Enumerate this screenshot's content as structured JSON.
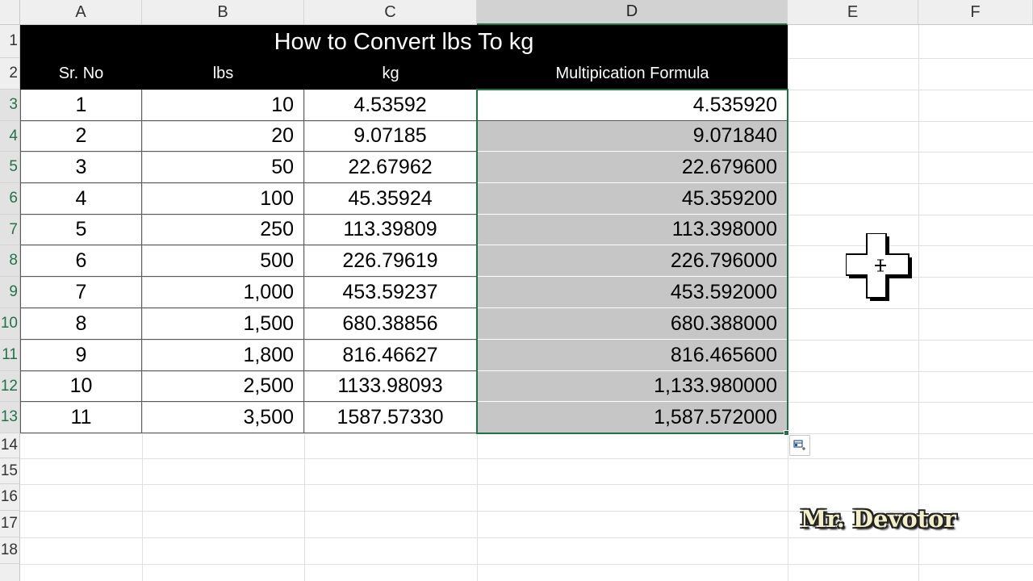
{
  "columns": [
    "A",
    "B",
    "C",
    "D",
    "E",
    "F"
  ],
  "rows": [
    "1",
    "2",
    "3",
    "4",
    "5",
    "6",
    "7",
    "8",
    "9",
    "10",
    "11",
    "12",
    "13",
    "14",
    "15",
    "16",
    "17",
    "18"
  ],
  "title": "How to Convert lbs To kg",
  "headers": [
    "Sr. No",
    "lbs",
    "kg",
    "Multipication Formula"
  ],
  "table": [
    [
      "1",
      "10",
      "4.53592",
      "4.535920"
    ],
    [
      "2",
      "20",
      "9.07185",
      "9.071840"
    ],
    [
      "3",
      "50",
      "22.67962",
      "22.679600"
    ],
    [
      "4",
      "100",
      "45.35924",
      "45.359200"
    ],
    [
      "5",
      "250",
      "113.39809",
      "113.398000"
    ],
    [
      "6",
      "500",
      "226.79619",
      "226.796000"
    ],
    [
      "7",
      "1,000",
      "453.59237",
      "453.592000"
    ],
    [
      "8",
      "1,500",
      "680.38856",
      "680.388000"
    ],
    [
      "9",
      "1,800",
      "816.46627",
      "816.465600"
    ],
    [
      "10",
      "2,500",
      "1133.98093",
      "1,133.980000"
    ],
    [
      "11",
      "3,500",
      "1587.57330",
      "1,587.572000"
    ]
  ],
  "watermark": "Mr. Devotor",
  "selection": {
    "column": "D",
    "rows": "3:13"
  },
  "colors": {
    "accent": "#217346",
    "selection_fill": "#c6c6c6",
    "header_fill": "#000000"
  }
}
